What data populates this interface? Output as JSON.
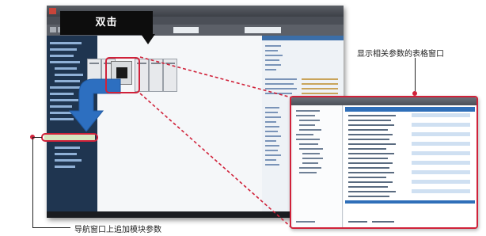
{
  "callout": {
    "label": "双击"
  },
  "captions": {
    "right": "显示相关参数的表格窗口",
    "bottom": "导航窗口上追加模块参数"
  },
  "colors": {
    "highlight": "#d0223a",
    "arrow": "#2d6fc0",
    "callout_bg": "#0d0d0d",
    "nav_bg": "#1f3550"
  },
  "icons": [
    "double-click-callout",
    "blue-arrow",
    "module-icon"
  ]
}
